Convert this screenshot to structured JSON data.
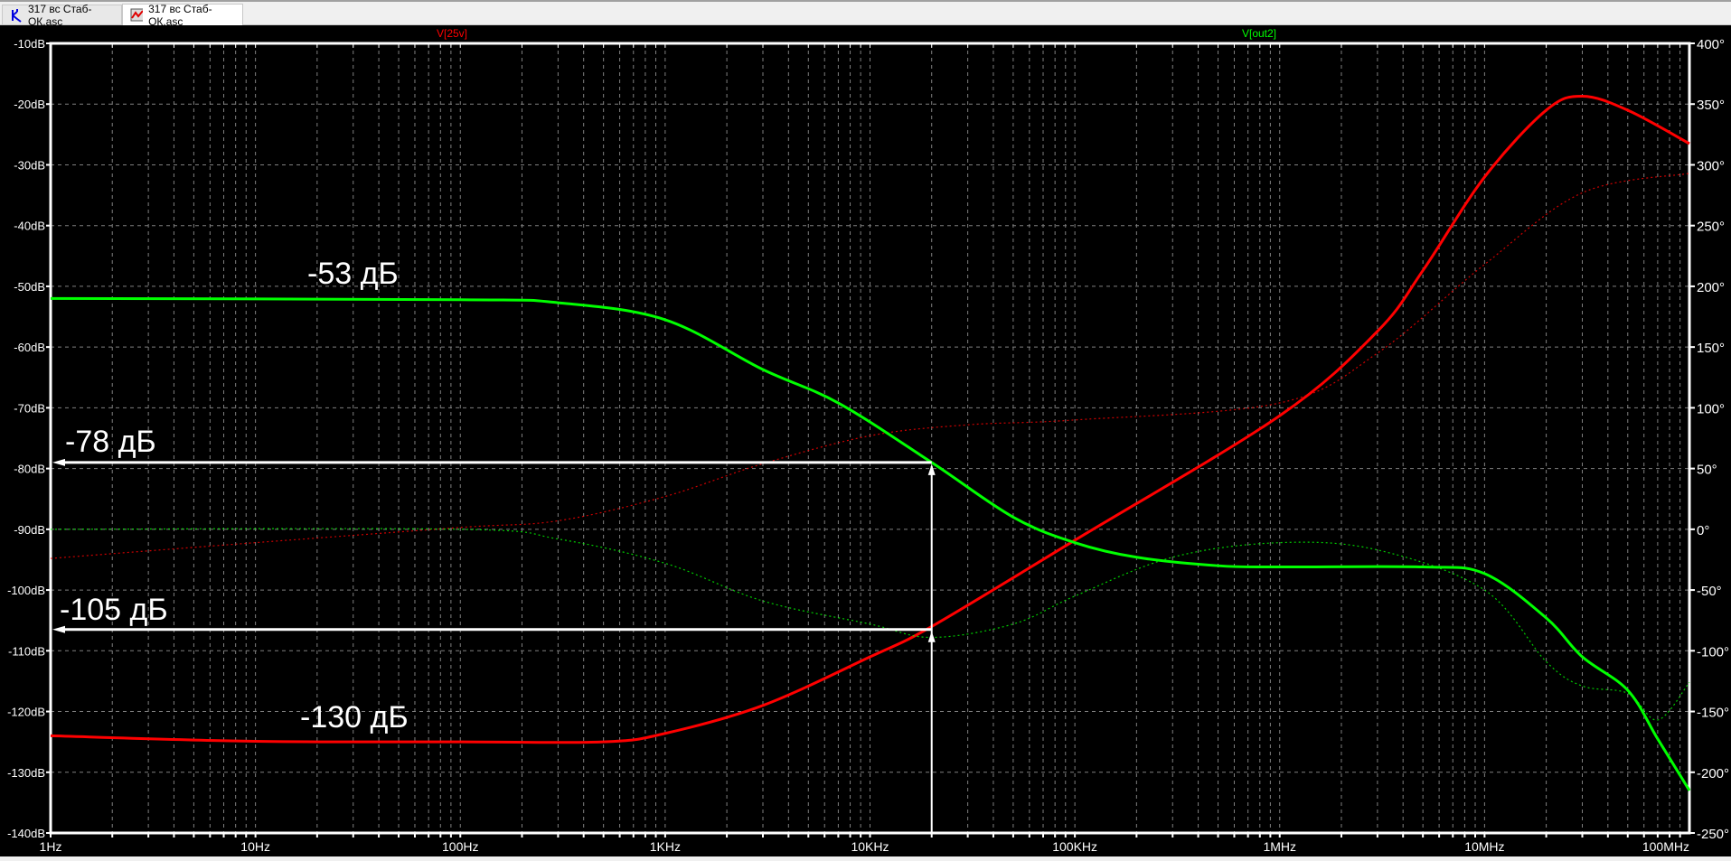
{
  "tabs": [
    {
      "label": "317 вс Стаб-ОК.asc",
      "icon": "schematic-icon",
      "active": false
    },
    {
      "label": "317 вс Стаб-ОК.asc",
      "icon": "waveform-icon",
      "active": true
    }
  ],
  "chart_data": {
    "type": "line",
    "xscale": "log",
    "xlim": [
      1,
      100000000
    ],
    "ylim_left": [
      -140,
      -10
    ],
    "ylim_right": [
      -250,
      400
    ],
    "grid": true,
    "x_tick_labels": [
      "1Hz",
      "10Hz",
      "100Hz",
      "1KHz",
      "10KHz",
      "100KHz",
      "1MHz",
      "10MHz",
      "100MHz"
    ],
    "left_tick_labels": [
      "-10dB",
      "-20dB",
      "-30dB",
      "-40dB",
      "-50dB",
      "-60dB",
      "-70dB",
      "-80dB",
      "-90dB",
      "-100dB",
      "-110dB",
      "-120dB",
      "-130dB",
      "-140dB"
    ],
    "right_tick_labels": [
      "400°",
      "350°",
      "300°",
      "250°",
      "200°",
      "150°",
      "100°",
      "50°",
      "0°",
      "-50°",
      "-100°",
      "-150°",
      "-200°",
      "-250°"
    ],
    "series": [
      {
        "name": "V[25v]",
        "color": "#ff0000",
        "magnitude_db": {
          "x": [
            1,
            10,
            100,
            500,
            1000,
            3000,
            10000,
            20000,
            100000,
            1000000,
            3000000,
            5000000,
            10000000,
            20000000,
            30000000,
            50000000,
            100000000
          ],
          "y": [
            -124,
            -124.9,
            -125,
            -125,
            -123.6,
            -119,
            -111,
            -106,
            -91.8,
            -71.3,
            -57.4,
            -47.4,
            -32,
            -21,
            -18.7,
            -21,
            -26.5
          ]
        },
        "phase_deg": {
          "x": [
            1,
            10,
            100,
            300,
            1000,
            3000,
            10000,
            30000,
            100000,
            1000000,
            3000000,
            10000000,
            30000000,
            100000000
          ],
          "y": [
            -24,
            -11,
            1.5,
            7,
            27,
            54,
            77,
            86,
            90,
            104,
            145,
            218,
            277,
            293
          ]
        }
      },
      {
        "name": "V[out2]",
        "color": "#00ff00",
        "magnitude_db": {
          "x": [
            1,
            100,
            300,
            1000,
            3000,
            7000,
            20000,
            50000,
            100000,
            200000,
            500000,
            1000000,
            5000000,
            10000000,
            20000000,
            30000000,
            50000000,
            70000000,
            100000000
          ],
          "y": [
            -52,
            -52.2,
            -52.7,
            -55.5,
            -63.7,
            -69.2,
            -79,
            -88,
            -92.2,
            -94.6,
            -96,
            -96.2,
            -96.2,
            -97.3,
            -104.6,
            -111,
            -116.5,
            -124.5,
            -133
          ]
        },
        "phase_deg": {
          "x": [
            1,
            100,
            300,
            1000,
            3000,
            10000,
            20000,
            50000,
            100000,
            300000,
            1000000,
            3000000,
            10000000,
            20000000,
            30000000,
            50000000,
            70000000,
            100000000
          ],
          "y": [
            0,
            0,
            -8,
            -28,
            -59,
            -78,
            -89,
            -78,
            -55,
            -23,
            -11,
            -17,
            -50,
            -109,
            -129,
            -135,
            -157,
            -126
          ]
        }
      }
    ],
    "annotations": [
      {
        "text": "-53 дБ"
      },
      {
        "text": "-78 дБ"
      },
      {
        "text": "-105 дБ"
      },
      {
        "text": "-130 дБ"
      }
    ],
    "markers": {
      "frequency_hz": 20000,
      "levels_db": [
        -79,
        -106.5
      ]
    }
  }
}
